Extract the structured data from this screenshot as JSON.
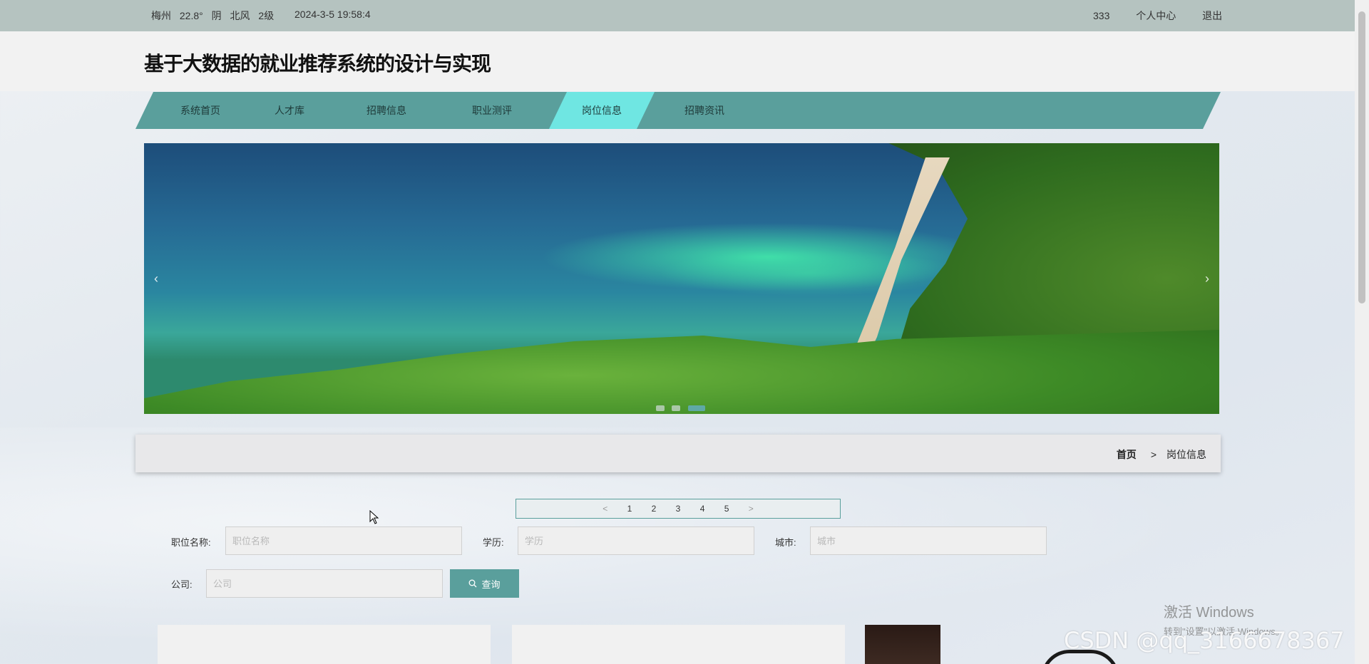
{
  "topbar": {
    "weather": {
      "city": "梅州",
      "temperature": "22.8°",
      "condition": "阴",
      "wind": "北风",
      "wind_level": "2级"
    },
    "datetime": "2024-3-5 19:58:4",
    "user": "333",
    "profile_link": "个人中心",
    "logout_link": "退出"
  },
  "header": {
    "title": "基于大数据的就业推荐系统的设计与实现"
  },
  "nav": {
    "items": [
      {
        "label": "系统首页"
      },
      {
        "label": "人才库"
      },
      {
        "label": "招聘信息"
      },
      {
        "label": "职业测评"
      },
      {
        "label": "岗位信息",
        "active": true
      },
      {
        "label": "招聘资讯"
      }
    ]
  },
  "banner": {
    "prev_icon": "chevron-left-icon",
    "next_icon": "chevron-right-icon",
    "prev_glyph": "‹",
    "next_glyph": "›",
    "slide_count": 3,
    "active_slide": 3
  },
  "breadcrumb": {
    "home": "首页",
    "separator": ">",
    "current": "岗位信息"
  },
  "pager": {
    "prev": "<",
    "next": ">",
    "pages": [
      "1",
      "2",
      "3",
      "4",
      "5"
    ]
  },
  "search": {
    "job_title": {
      "label": "职位名称:",
      "placeholder": "职位名称",
      "value": ""
    },
    "education": {
      "label": "学历:",
      "placeholder": "学历",
      "value": ""
    },
    "city": {
      "label": "城市:",
      "placeholder": "城市",
      "value": ""
    },
    "company": {
      "label": "公司:",
      "placeholder": "公司",
      "value": ""
    },
    "button_label": "查询",
    "button_icon": "search-icon"
  },
  "overlay": {
    "windows_activation_title": "激活 Windows",
    "windows_activation_hint": "转到\"设置\"以激活 Windows。",
    "csdn_watermark": "CSDN @qq_3166678367"
  },
  "colors": {
    "accent": "#5a9f9c",
    "nav_active": "#6fe6e2",
    "topbar": "#b5c3c0"
  }
}
